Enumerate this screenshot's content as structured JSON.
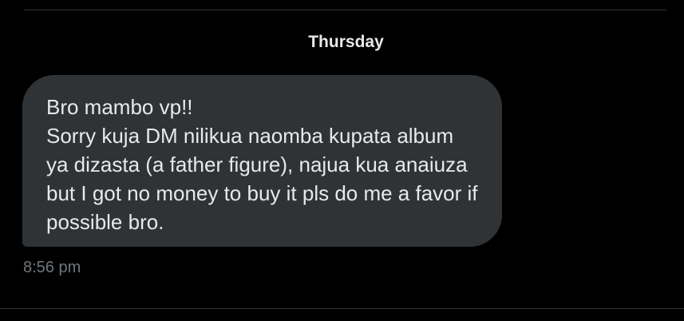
{
  "conversation": {
    "day_separator": "Thursday",
    "message": {
      "lines": [
        "Bro mambo vp!!",
        "Sorry kuja DM nilikua naomba kupata album",
        "ya dizasta (a father figure), najua kua anaiuza",
        "but I got no money to buy it pls do me a favor if",
        "possible bro."
      ],
      "time": "8:56 pm"
    }
  },
  "colors": {
    "background": "#000000",
    "bubble": "#2f3336",
    "text": "#e7e9ea",
    "muted_text": "#71767b",
    "divider": "#2f3336"
  }
}
